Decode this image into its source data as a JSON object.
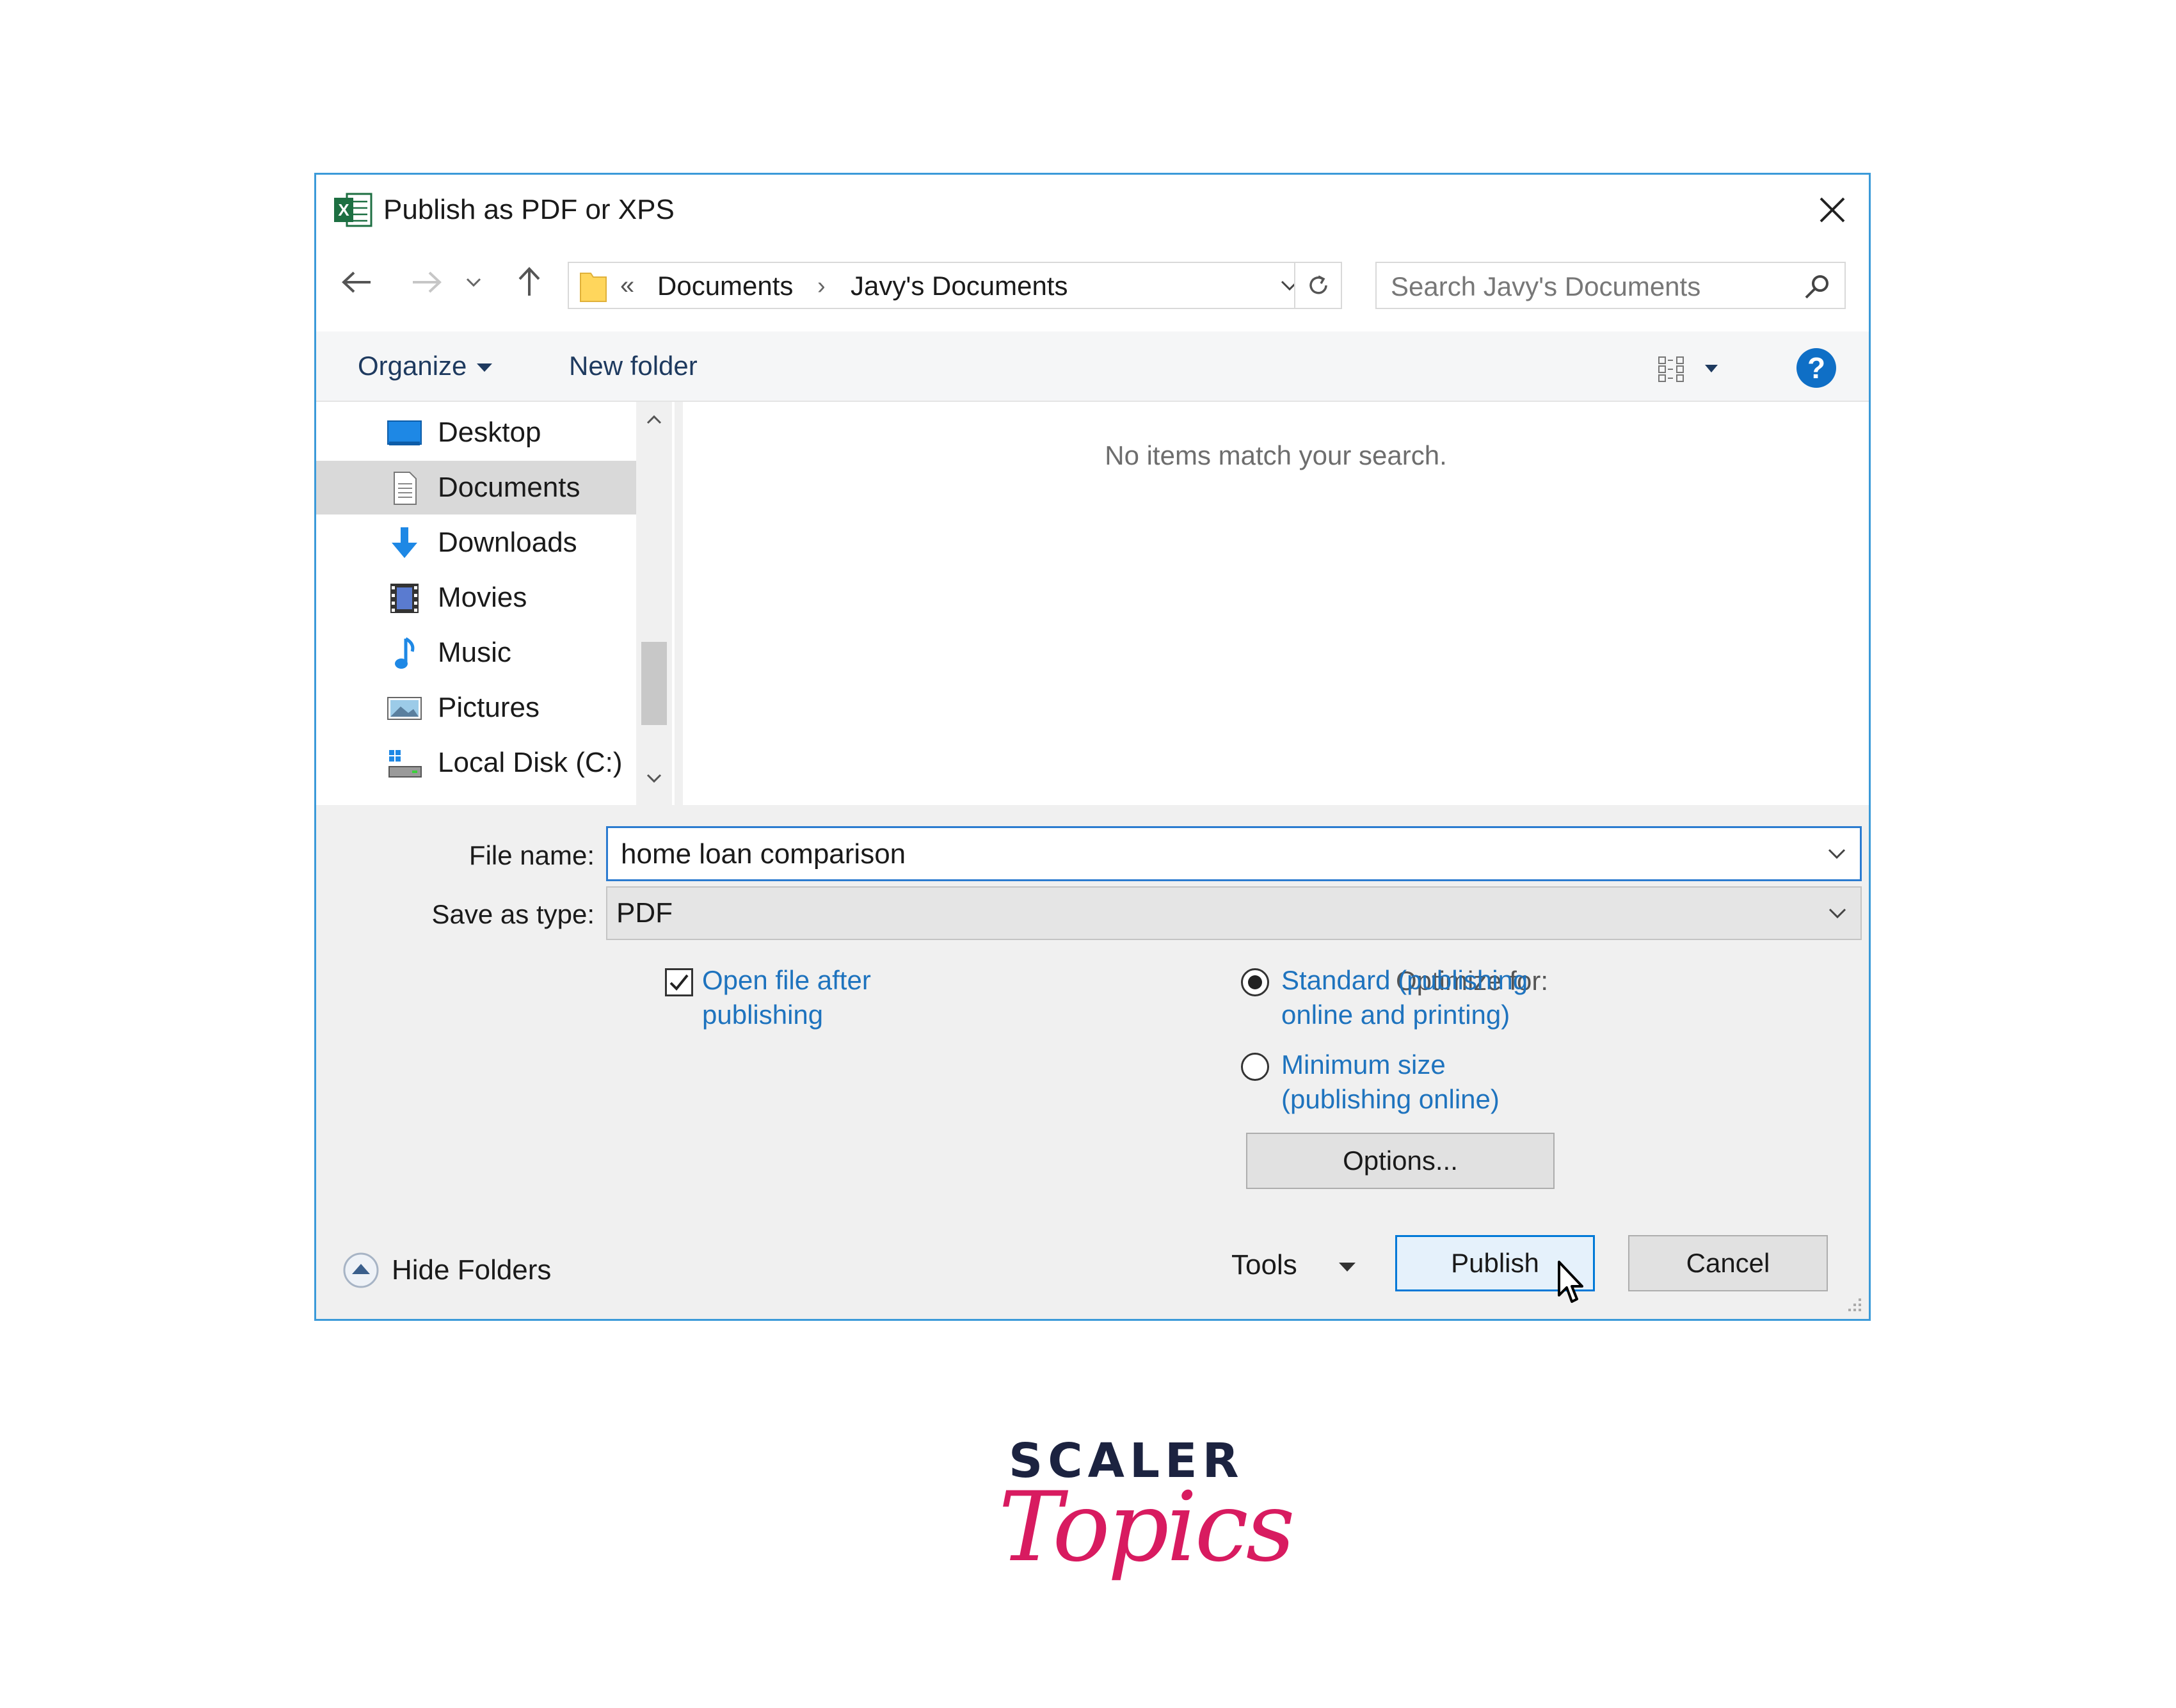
{
  "window": {
    "title": "Publish as PDF or XPS"
  },
  "nav": {
    "breadcrumb_prefix": "«",
    "breadcrumbs": [
      "Documents",
      "Javy's Documents"
    ],
    "breadcrumb_separator": "›",
    "search_placeholder": "Search Javy's Documents"
  },
  "toolbar": {
    "organize_label": "Organize",
    "new_folder_label": "New folder",
    "help_label": "?"
  },
  "sidebar": {
    "items": [
      {
        "label": "Desktop",
        "icon": "desktop-icon",
        "selected": false
      },
      {
        "label": "Documents",
        "icon": "documents-icon",
        "selected": true
      },
      {
        "label": "Downloads",
        "icon": "downloads-icon",
        "selected": false
      },
      {
        "label": "Movies",
        "icon": "movies-icon",
        "selected": false
      },
      {
        "label": "Music",
        "icon": "music-icon",
        "selected": false
      },
      {
        "label": "Pictures",
        "icon": "pictures-icon",
        "selected": false
      },
      {
        "label": "Local Disk (C:)",
        "icon": "local-disk-icon",
        "selected": false
      }
    ]
  },
  "content": {
    "empty_message": "No items match your search."
  },
  "form": {
    "file_name_label": "File name:",
    "file_name_value": "home loan comparison",
    "save_type_label": "Save as type:",
    "save_type_value": "PDF",
    "open_after_line1": "Open file after",
    "open_after_line2": "publishing",
    "open_after_checked": true,
    "optimize_label": "Optimize for:",
    "standard_line1": "Standard (publishing",
    "standard_line2": "online and printing)",
    "minimum_line1": "Minimum size",
    "minimum_line2": "(publishing online)",
    "optimize_selected": "standard",
    "options_label": "Options..."
  },
  "footer": {
    "hide_folders_label": "Hide Folders",
    "tools_label": "Tools",
    "publish_label": "Publish",
    "cancel_label": "Cancel"
  },
  "logo": {
    "line1": "SCALER",
    "line2": "Topics"
  },
  "colors": {
    "accent": "#0078d7",
    "link": "#1e73be",
    "border": "#3b9ad9",
    "logo_pink": "#d81b60",
    "logo_navy": "#1c2340"
  }
}
